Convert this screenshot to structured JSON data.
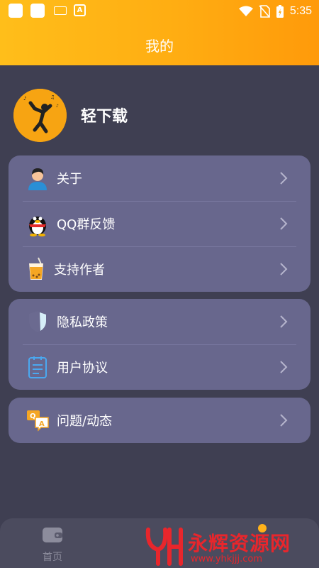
{
  "status_bar": {
    "time": "5:35"
  },
  "header": {
    "title": "我的"
  },
  "profile": {
    "app_name": "轻下载"
  },
  "groups": [
    {
      "items": [
        {
          "label": "关于",
          "icon": "user-icon"
        },
        {
          "label": "QQ群反馈",
          "icon": "qq-penguin-icon"
        },
        {
          "label": "支持作者",
          "icon": "drink-cup-icon"
        }
      ]
    },
    {
      "items": [
        {
          "label": "隐私政策",
          "icon": "shield-icon"
        },
        {
          "label": "用户协议",
          "icon": "document-icon"
        }
      ]
    },
    {
      "items": [
        {
          "label": "问题/动态",
          "icon": "qa-chat-icon"
        }
      ]
    }
  ],
  "tabbar": {
    "home_label": "首页"
  },
  "watermark": {
    "text": "永辉资源网",
    "url": "www.yhkjjj.com"
  },
  "colors": {
    "header_start": "#ffbe1a",
    "header_end": "#ff9a0a",
    "card": "#68678d",
    "background": "#3f3f52",
    "watermark": "#e8262c"
  }
}
